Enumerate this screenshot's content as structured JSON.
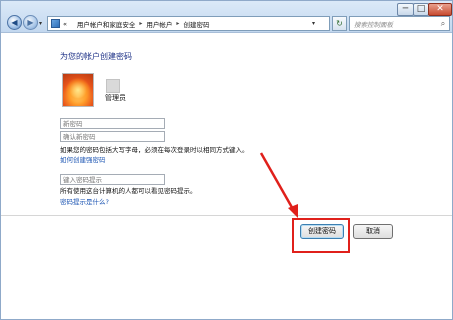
{
  "window": {
    "controls": {
      "minimize": "─",
      "maximize": "□",
      "close": "✕"
    }
  },
  "nav": {
    "back_glyph": "◀",
    "forward_glyph": "▶",
    "dropdown_glyph": "▾",
    "refresh_glyph": "↻"
  },
  "address": {
    "prefix": "«",
    "crumbs": [
      "用户帐户和家庭安全",
      "用户帐户",
      "创建密码"
    ],
    "separator": "▸",
    "dropdown_glyph": "▾"
  },
  "search": {
    "placeholder": "搜索控制面板",
    "icon": "search-icon",
    "icon_glyph": "⌕"
  },
  "page": {
    "heading": "为您的帐户创建密码",
    "account_name": "管理员",
    "new_password_placeholder": "新密码",
    "confirm_password_placeholder": "确认新密码",
    "case_note": "如果您的密码包括大写字母，必须在每次登录时以相同方式键入。",
    "how_to_link": "如何创建强密码",
    "hint_placeholder": "键入密码提示",
    "hint_note": "所有使用这台计算机的人都可以看见密码提示。",
    "what_hint_link": "密码提示是什么?"
  },
  "buttons": {
    "create": "创建密码",
    "cancel": "取消"
  },
  "annotation": {
    "color": "#e0201b"
  }
}
